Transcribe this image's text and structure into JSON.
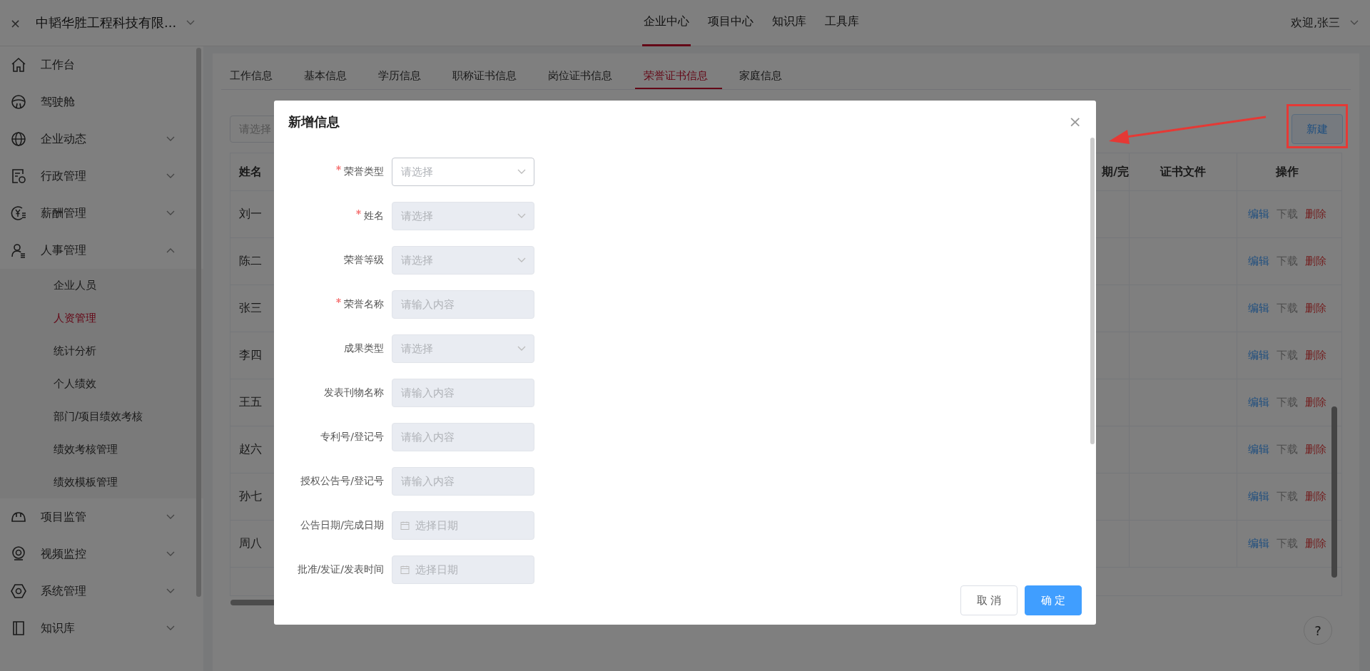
{
  "top_bar": {
    "close_glyph": "×",
    "company": "中韬华胜工程科技有限...",
    "nav": [
      {
        "label": "企业中心",
        "selected": true
      },
      {
        "label": "项目中心",
        "selected": false
      },
      {
        "label": "知识库",
        "selected": false
      },
      {
        "label": "工具库",
        "selected": false
      }
    ],
    "user": "欢迎,张三"
  },
  "sidebar": {
    "items": [
      {
        "label": "工作台"
      },
      {
        "label": "驾驶舱"
      },
      {
        "label": "企业动态",
        "expanded": false
      },
      {
        "label": "行政管理",
        "expanded": false
      },
      {
        "label": "薪酬管理",
        "expanded": false
      },
      {
        "label": "人事管理",
        "expanded": true,
        "children": [
          {
            "label": "企业人员",
            "selected": false
          },
          {
            "label": "人资管理",
            "selected": true
          },
          {
            "label": "统计分析",
            "selected": false
          },
          {
            "label": "个人绩效",
            "selected": false
          },
          {
            "label": "部门/项目绩效考核",
            "selected": false
          },
          {
            "label": "绩效考核管理",
            "selected": false
          },
          {
            "label": "绩效模板管理",
            "selected": false
          }
        ]
      },
      {
        "label": "项目监管",
        "expanded": false
      },
      {
        "label": "视频监控",
        "expanded": false
      },
      {
        "label": "系统管理",
        "expanded": false
      },
      {
        "label": "知识库",
        "expanded": false
      }
    ]
  },
  "tabs": [
    {
      "label": "工作信息",
      "selected": false
    },
    {
      "label": "基本信息",
      "selected": false
    },
    {
      "label": "学历信息",
      "selected": false
    },
    {
      "label": "职称证书信息",
      "selected": false
    },
    {
      "label": "岗位证书信息",
      "selected": false
    },
    {
      "label": "荣誉证书信息",
      "selected": true
    },
    {
      "label": "家庭信息",
      "selected": false
    }
  ],
  "filter": {
    "placeholder": "请选择"
  },
  "new_button": "新建",
  "table": {
    "columns": [
      "姓名",
      "期/完",
      "证书文件",
      "操作"
    ],
    "rows": [
      {
        "name": "刘一",
        "actions": [
          {
            "label": "编辑",
            "kind": "edit"
          },
          {
            "label": "下载",
            "kind": "download"
          },
          {
            "label": "删除",
            "kind": "delete"
          }
        ]
      },
      {
        "name": "陈二",
        "actions": [
          {
            "label": "编辑",
            "kind": "edit"
          },
          {
            "label": "下载",
            "kind": "download"
          },
          {
            "label": "删除",
            "kind": "delete"
          }
        ]
      },
      {
        "name": "张三",
        "actions": [
          {
            "label": "编辑",
            "kind": "edit"
          },
          {
            "label": "下载",
            "kind": "download"
          },
          {
            "label": "删除",
            "kind": "delete"
          }
        ]
      },
      {
        "name": "李四",
        "actions": [
          {
            "label": "编辑",
            "kind": "edit"
          },
          {
            "label": "下载",
            "kind": "download"
          },
          {
            "label": "删除",
            "kind": "delete"
          }
        ]
      },
      {
        "name": "王五",
        "actions": [
          {
            "label": "编辑",
            "kind": "edit"
          },
          {
            "label": "下载",
            "kind": "download"
          },
          {
            "label": "删除",
            "kind": "delete"
          }
        ]
      },
      {
        "name": "赵六",
        "actions": [
          {
            "label": "编辑",
            "kind": "edit"
          },
          {
            "label": "下载",
            "kind": "download"
          },
          {
            "label": "删除",
            "kind": "delete"
          }
        ]
      },
      {
        "name": "孙七",
        "actions": [
          {
            "label": "编辑",
            "kind": "edit"
          },
          {
            "label": "下载",
            "kind": "download"
          },
          {
            "label": "删除",
            "kind": "delete"
          }
        ]
      },
      {
        "name": "周八",
        "actions": [
          {
            "label": "编辑",
            "kind": "edit"
          },
          {
            "label": "下载",
            "kind": "download"
          },
          {
            "label": "删除",
            "kind": "delete"
          }
        ]
      }
    ]
  },
  "help_button": "?",
  "dialog": {
    "title": "新增信息",
    "close_glyph": "×",
    "fields": [
      {
        "label": "荣誉类型",
        "required": true,
        "kind": "select",
        "placeholder": "请选择",
        "focused": true
      },
      {
        "label": "姓名",
        "required": true,
        "kind": "select",
        "placeholder": "请选择",
        "focused": false
      },
      {
        "label": "荣誉等级",
        "required": false,
        "kind": "select",
        "placeholder": "请选择",
        "focused": false
      },
      {
        "label": "荣誉名称",
        "required": true,
        "kind": "input",
        "placeholder": "请输入内容",
        "focused": false
      },
      {
        "label": "成果类型",
        "required": false,
        "kind": "select",
        "placeholder": "请选择",
        "focused": false
      },
      {
        "label": "发表刊物名称",
        "required": false,
        "kind": "input",
        "placeholder": "请输入内容",
        "focused": false
      },
      {
        "label": "专利号/登记号",
        "required": false,
        "kind": "input",
        "placeholder": "请输入内容",
        "focused": false
      },
      {
        "label": "授权公告号/登记号",
        "required": false,
        "kind": "input",
        "placeholder": "请输入内容",
        "focused": false
      },
      {
        "label": "公告日期/完成日期",
        "required": false,
        "kind": "date",
        "placeholder": "选择日期",
        "focused": false
      },
      {
        "label": "批准/发证/发表时间",
        "required": false,
        "kind": "date",
        "placeholder": "选择日期",
        "focused": false
      }
    ],
    "buttons": [
      {
        "label": "取 消",
        "kind": "secondary"
      },
      {
        "label": "确 定",
        "kind": "primary"
      }
    ]
  }
}
